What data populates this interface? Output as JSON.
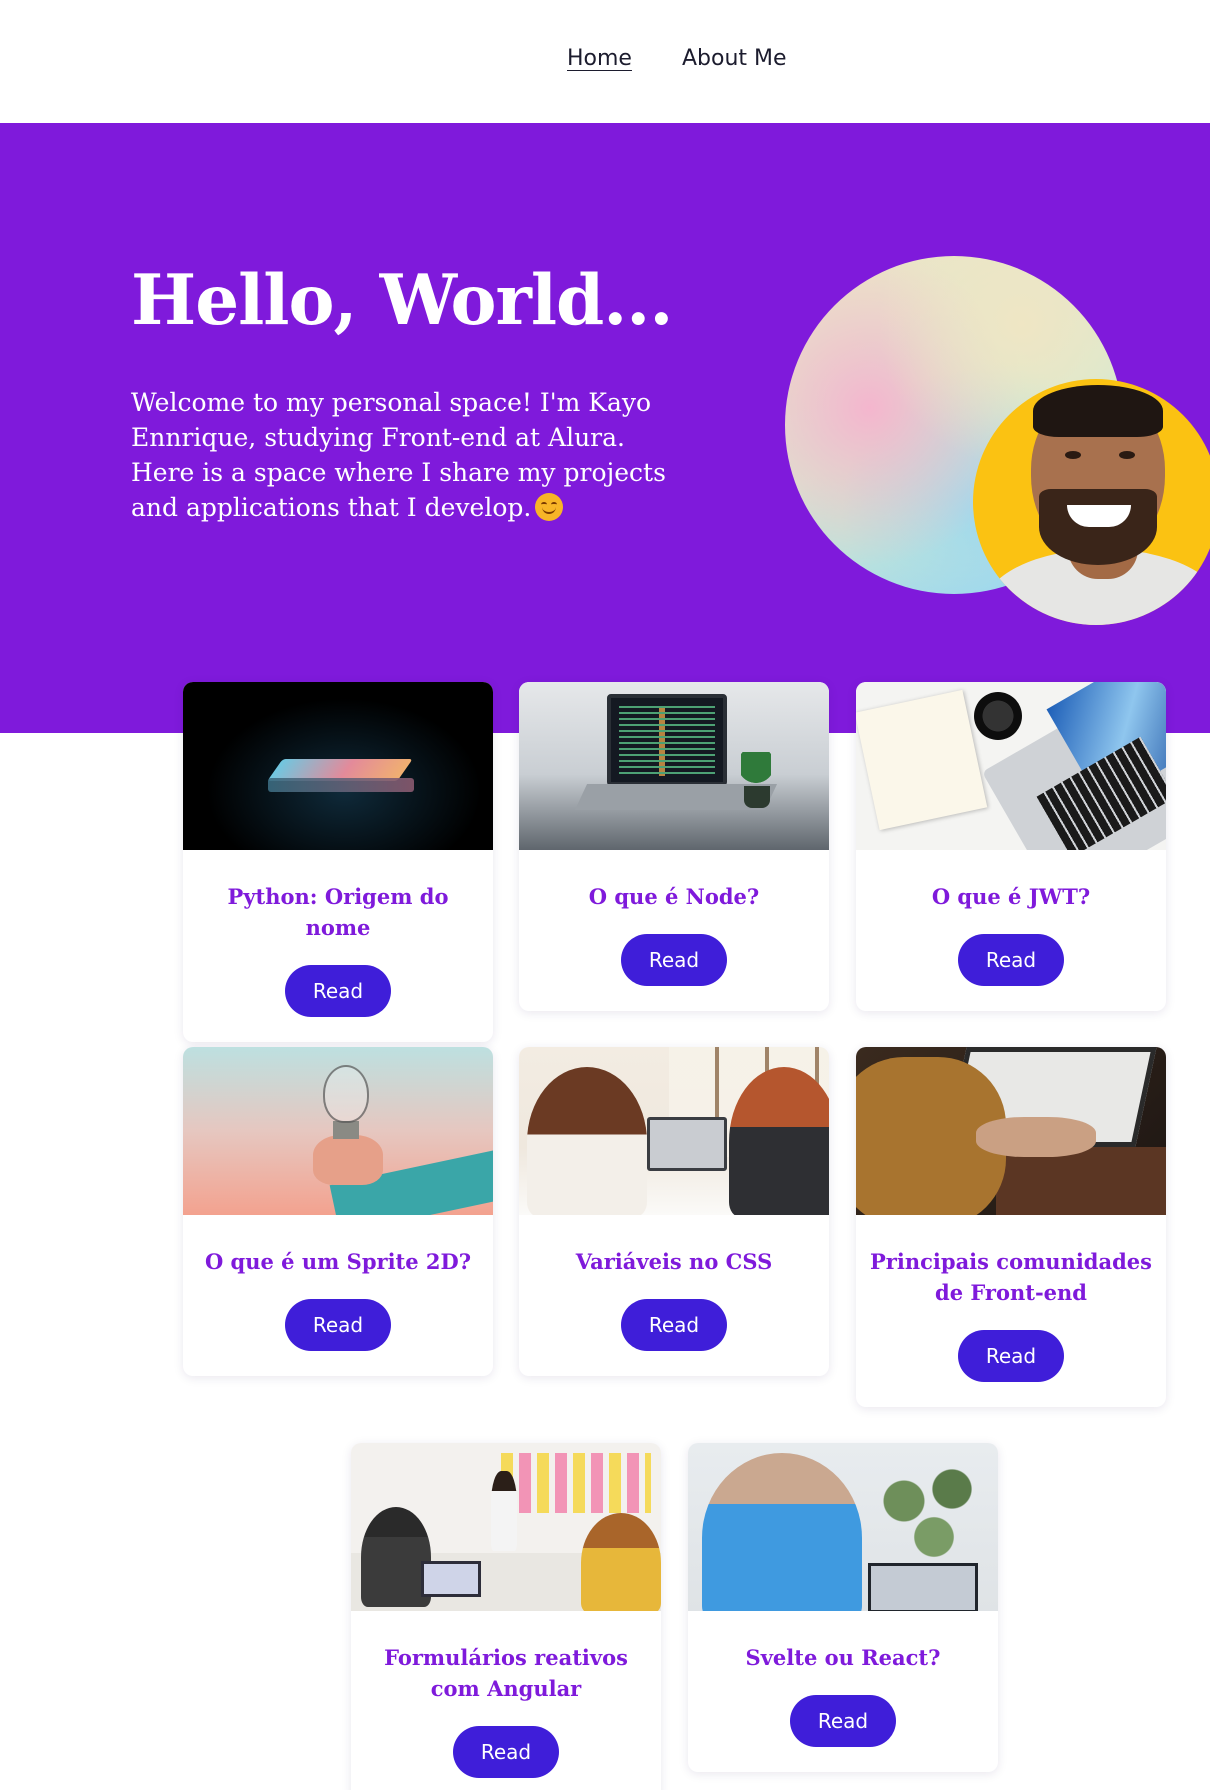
{
  "nav": {
    "items": [
      {
        "label": "Home",
        "active": true
      },
      {
        "label": "About Me",
        "active": false
      }
    ]
  },
  "hero": {
    "title": "Hello, World...",
    "paragraph_1": "Welcome to my personal space! I'm Kayo Ennrique, studying Front-end at Alura.",
    "paragraph_2": "Here is a space where I share my projects and applications that I develop.",
    "emoji": "smiling-face-icon",
    "avatar": "profile-photo"
  },
  "colors": {
    "hero_background": "#7f1adb",
    "card_title": "#7f1adb",
    "button_background": "#3f1ed9",
    "avatar_background": "#fbc212"
  },
  "posts": {
    "button_label": "Read",
    "items": [
      {
        "title": "Python: Origem do nome",
        "image": "closed-laptop-image"
      },
      {
        "title": "O que é Node?",
        "image": "laptop-code-image"
      },
      {
        "title": "O que é JWT?",
        "image": "desk-laptop-image"
      },
      {
        "title": "O que é um Sprite 2D?",
        "image": "lightbulb-image"
      },
      {
        "title": "Variáveis no CSS",
        "image": "meeting-image"
      },
      {
        "title": "Principais comunidades de Front-end",
        "image": "typing-image"
      },
      {
        "title": "Formulários reativos com Angular",
        "image": "office-meeting-image"
      },
      {
        "title": "Svelte ou React?",
        "image": "person-laptop-image"
      }
    ]
  }
}
